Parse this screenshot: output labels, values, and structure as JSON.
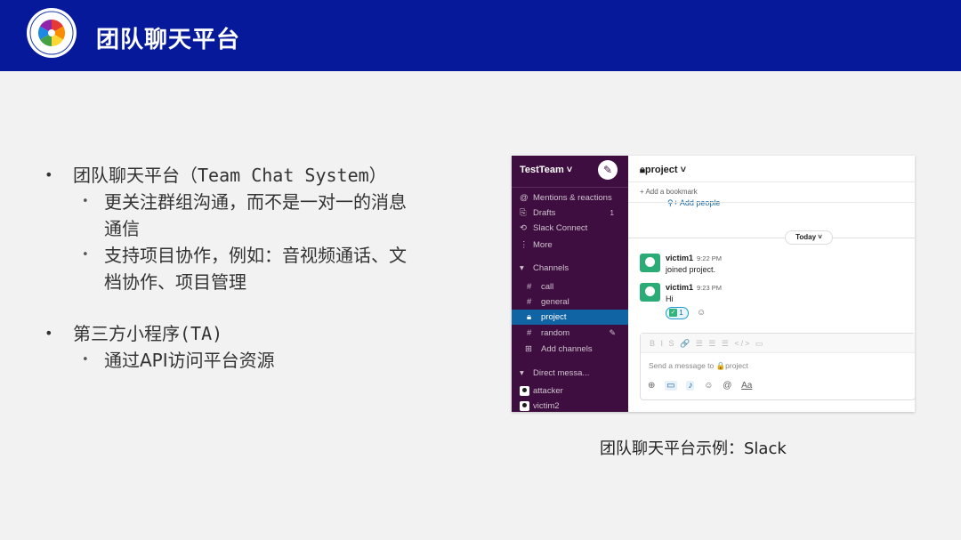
{
  "header": {
    "title": "团队聊天平台",
    "colors": {
      "background": "#06199a",
      "text": "#ffffff"
    }
  },
  "bullets": [
    {
      "text": "团队聊天平台（Team Chat System）",
      "sub": [
        {
          "line1": "更关注群组沟通，而不是一对一的消息",
          "line2": "通信"
        },
        {
          "line1": "支持项目协作，例如：音视频通话、文",
          "line2": "档协作、项目管理"
        }
      ]
    },
    {
      "text": "第三方小程序(TA)",
      "sub": [
        {
          "line1": "通过API访问平台资源"
        }
      ]
    }
  ],
  "slack": {
    "colors": {
      "sidebar": "#3f0e40",
      "active": "#1164a3",
      "avatar": "#2bac76"
    },
    "team": "TestTeam ˅",
    "sidebar": {
      "mentions": "Mentions & reactions",
      "drafts": "Drafts",
      "drafts_count": "1",
      "connect": "Slack Connect",
      "more": "More",
      "channels_header": "Channels",
      "channels": [
        "call",
        "general",
        "project",
        "random"
      ],
      "add_channels": "Add channels",
      "dm_header": "Direct messa...",
      "dms": [
        "attacker",
        "victim2"
      ]
    },
    "channel": {
      "name": "project ˅",
      "bookmark": "Add a bookmark",
      "add_people": "Add people",
      "today": "Today ˅"
    },
    "messages": [
      {
        "user": "victim1",
        "time": "9:22 PM",
        "text": "joined project."
      },
      {
        "user": "victim1",
        "time": "9:23 PM",
        "text": "Hi",
        "reaction_count": "1"
      }
    ],
    "composer": {
      "placeholder": "Send a message to 🔒project",
      "format_icons": "B I S 🔗 ☰ ☰ ☰ </> ▭",
      "aa": "Aa"
    }
  },
  "caption": "团队聊天平台示例：Slack"
}
